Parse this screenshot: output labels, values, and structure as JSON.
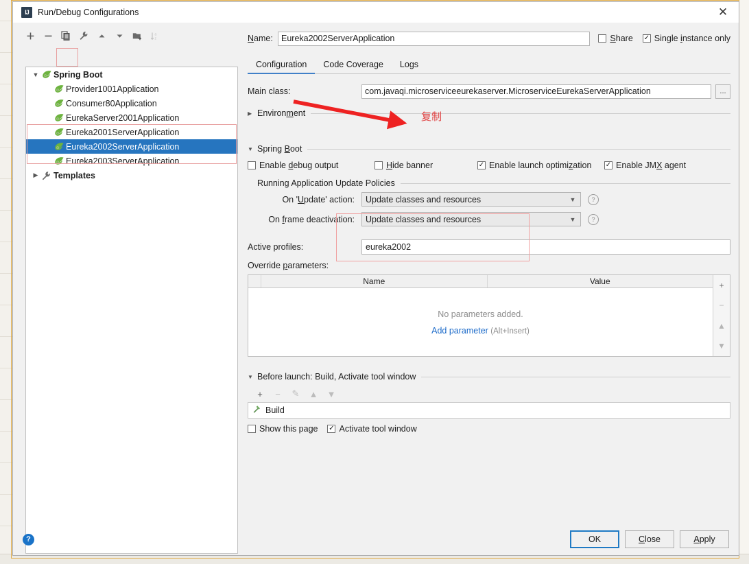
{
  "window": {
    "title": "Run/Debug Configurations",
    "app_icon": "intellij-idea-icon",
    "close_label": "✕"
  },
  "tree_toolbar": {
    "buttons": [
      {
        "name": "add-configuration-button",
        "icon": "plus-icon",
        "label": "+"
      },
      {
        "name": "remove-configuration-button",
        "icon": "minus-icon",
        "label": "−"
      },
      {
        "name": "copy-configuration-button",
        "icon": "copy-icon",
        "label": ""
      },
      {
        "name": "edit-templates-button",
        "icon": "wrench-icon",
        "label": ""
      },
      {
        "name": "move-up-button",
        "icon": "arrow-up-icon",
        "label": ""
      },
      {
        "name": "move-down-button",
        "icon": "arrow-down-icon",
        "label": ""
      },
      {
        "name": "create-folder-button",
        "icon": "folder-add-icon",
        "label": ""
      },
      {
        "name": "sort-configurations-button",
        "icon": "sort-az-icon",
        "label": ""
      }
    ]
  },
  "tree": {
    "group_label": "Spring Boot",
    "group_icon": "spring-boot-icon",
    "items": [
      {
        "label": "Provider1001Application",
        "icon": "spring-boot-icon",
        "selected": false
      },
      {
        "label": "Consumer80Application",
        "icon": "spring-boot-icon",
        "selected": false
      },
      {
        "label": "EurekaServer2001Application",
        "icon": "spring-boot-icon",
        "selected": false
      },
      {
        "label": "Eureka2001ServerApplication",
        "icon": "spring-boot-icon",
        "selected": false
      },
      {
        "label": "Eureka2002ServerApplication",
        "icon": "spring-boot-icon",
        "selected": true
      },
      {
        "label": "Eureka2003ServerApplication",
        "icon": "spring-boot-icon",
        "selected": false
      }
    ],
    "templates_label": "Templates",
    "templates_icon": "wrench-icon"
  },
  "header": {
    "name_label": "Name:",
    "name_value": "Eureka2002ServerApplication",
    "share_label": "Share",
    "share_checked": false,
    "single_instance_label": "Single instance only",
    "single_instance_checked": true
  },
  "tabs": [
    {
      "label": "Configuration",
      "active": true
    },
    {
      "label": "Code Coverage",
      "active": false
    },
    {
      "label": "Logs",
      "active": false
    }
  ],
  "configuration": {
    "main_class_label": "Main class:",
    "main_class_value": "com.javaqi.microserviceeurekaserver.MicroserviceEurekaServerApplication",
    "browse_label": "...",
    "environment_label": "Environment",
    "environment_expanded": false,
    "spring_boot_label": "Spring Boot",
    "spring_boot_expanded": true,
    "checkboxes": [
      {
        "label": "Enable debug output",
        "checked": false,
        "name": "enable-debug-output-checkbox"
      },
      {
        "label": "Hide banner",
        "checked": false,
        "name": "hide-banner-checkbox"
      },
      {
        "label": "Enable launch optimization",
        "checked": true,
        "name": "enable-launch-optimization-checkbox"
      },
      {
        "label": "Enable JMX agent",
        "checked": true,
        "name": "enable-jmx-agent-checkbox"
      }
    ],
    "policies_label": "Running Application Update Policies",
    "on_update_label": "On 'Update' action:",
    "on_update_value": "Update classes and resources",
    "on_frame_label": "On frame deactivation:",
    "on_frame_value": "Update classes and resources",
    "help_icon": "question-mark-icon",
    "active_profiles_label": "Active profiles:",
    "active_profiles_value": "eureka2002",
    "override_parameters_label": "Override parameters:"
  },
  "parameters_table": {
    "columns": [
      "Name",
      "Value"
    ],
    "rows": [],
    "empty_message": "No parameters added.",
    "add_link": "Add parameter",
    "add_hint": "(Alt+Insert)",
    "side_buttons": [
      {
        "name": "add-parameter-button",
        "icon": "plus-icon",
        "label": "+"
      },
      {
        "name": "remove-parameter-button",
        "icon": "minus-icon",
        "label": "−"
      },
      {
        "name": "move-parameter-up-button",
        "icon": "arrow-up-icon",
        "label": "▲"
      },
      {
        "name": "move-parameter-down-button",
        "icon": "arrow-down-icon",
        "label": "▼"
      }
    ]
  },
  "before_launch": {
    "header": "Before launch: Build, Activate tool window",
    "toolbar": [
      {
        "name": "add-task-button",
        "label": "+",
        "disabled": false
      },
      {
        "name": "remove-task-button",
        "label": "−",
        "disabled": true
      },
      {
        "name": "edit-task-button",
        "label": "✎",
        "disabled": true
      },
      {
        "name": "move-task-up-button",
        "label": "▲",
        "disabled": true
      },
      {
        "name": "move-task-down-button",
        "label": "▼",
        "disabled": true
      }
    ],
    "tasks": [
      {
        "label": "Build",
        "icon": "build-hammer-icon"
      }
    ],
    "show_page_label": "Show this page",
    "show_page_checked": false,
    "activate_tool_window_label": "Activate tool window",
    "activate_tool_window_checked": true
  },
  "footer": {
    "help_icon": "question-mark-icon",
    "buttons": [
      {
        "label": "OK",
        "name": "ok-button",
        "default": true
      },
      {
        "label": "Close",
        "name": "close-button",
        "default": false
      },
      {
        "label": "Apply",
        "name": "apply-button",
        "default": false
      }
    ]
  },
  "annotations": {
    "copy_text": "复制",
    "arrow_color": "#ee2222",
    "box_color": "#eda0a0"
  }
}
